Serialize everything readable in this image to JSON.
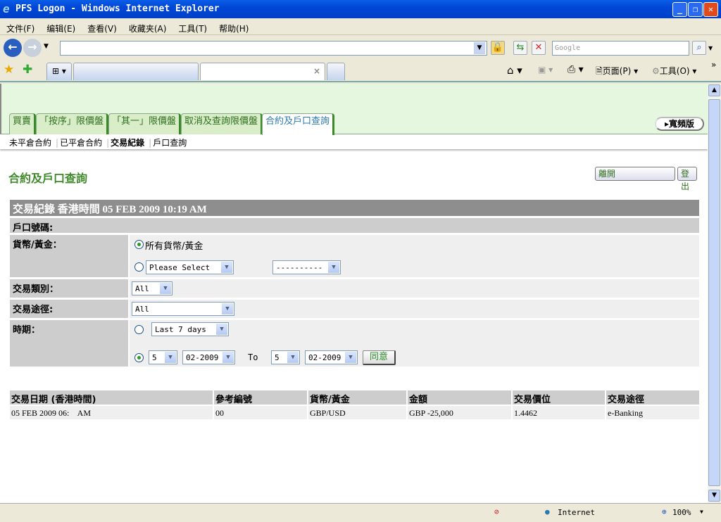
{
  "window": {
    "title": "PFS Logon - Windows Internet Explorer",
    "minimize": "_",
    "maximize": "❐",
    "close": "✕"
  },
  "menu": [
    "文件(F)",
    "编辑(E)",
    "查看(V)",
    "收藏夹(A)",
    "工具(T)",
    "帮助(H)"
  ],
  "search": {
    "placeholder": "Google"
  },
  "toolbar": {
    "page": "页面(P)",
    "tools": "工具(O)",
    "more": "»"
  },
  "page": {
    "tabs": [
      "買賣",
      "「按序」限價盤",
      "「其一」限價盤",
      "取消及查詢限價盤",
      "合約及戶口查詢"
    ],
    "wide_label": "寬頻版",
    "subnav": [
      "未平倉合約",
      "已平倉合約",
      "交易紀錄",
      "戶口查詢"
    ],
    "title": "合約及戶口查詢",
    "leave_button": "離開",
    "logout_button": "登出",
    "record_header": "交易紀錄 香港時間 05 FEB 2009 10:19 AM",
    "account_label": "戶口號碼:",
    "currency_label": "貨幣/黃金：",
    "currency_all": "所有貨幣/黃金",
    "currency_select": "Please Select",
    "currency_select2": "----------",
    "type_label": "交易類別：",
    "type_value": "All",
    "channel_label": "交易途徑:",
    "channel_value": "All",
    "period_label": "時期：",
    "period_value": "Last 7 days",
    "from_day": "5",
    "from_month": "02-2009",
    "to_label": "To",
    "to_day": "5",
    "to_month": "02-2009",
    "submit": "同意"
  },
  "results": {
    "headers": [
      "交易日期 (香港時間)",
      "參考編號",
      "貨幣/黃金",
      "金額",
      "交易價位",
      "交易途徑"
    ],
    "rows": [
      [
        "05 FEB 2009 06:    AM",
        "00",
        "GBP/USD",
        "GBP -25,000",
        "1.4462",
        "e-Banking"
      ]
    ]
  },
  "status": {
    "zone": "Internet",
    "zoom": "100%"
  }
}
